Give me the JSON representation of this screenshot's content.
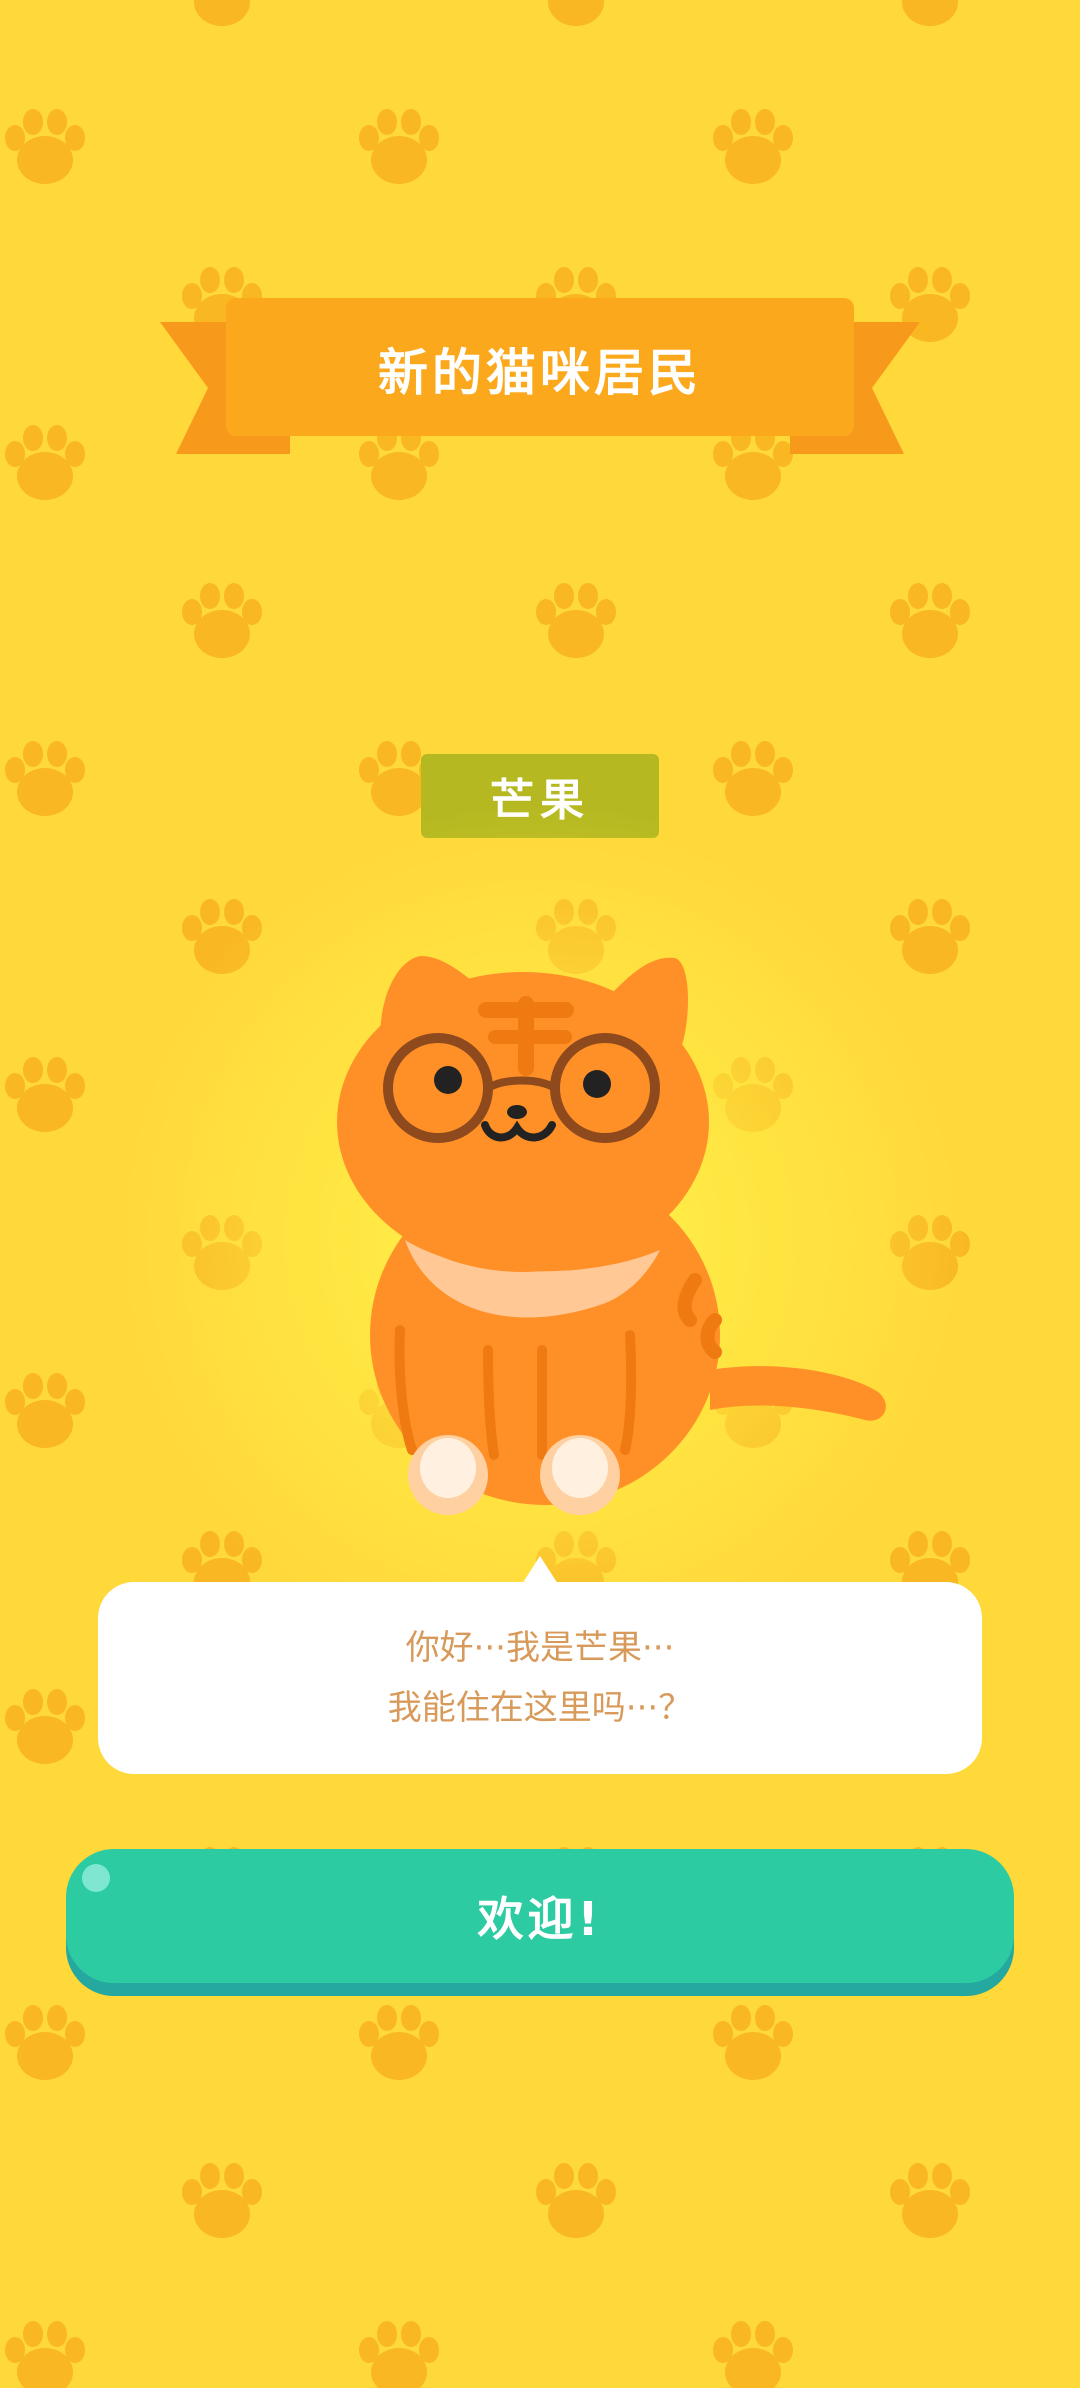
{
  "banner": {
    "title": "新的猫咪居民"
  },
  "cat": {
    "name": "芒果"
  },
  "dialog": {
    "line1": "你好···我是芒果···",
    "line2": "我能住在这里吗···？"
  },
  "actions": {
    "welcome_label": "欢迎!"
  },
  "colors": {
    "background": "#FFD83A",
    "paw": "#F9B722",
    "banner": "#FBA81C",
    "banner_ribbon": "#F79A1C",
    "name_tag": "#B5B820",
    "cat_body": "#FF9028",
    "button": "#2DCBA2",
    "dialog_text": "#D89A5A"
  },
  "icons": {
    "background_pattern": "paw-print-icon"
  }
}
